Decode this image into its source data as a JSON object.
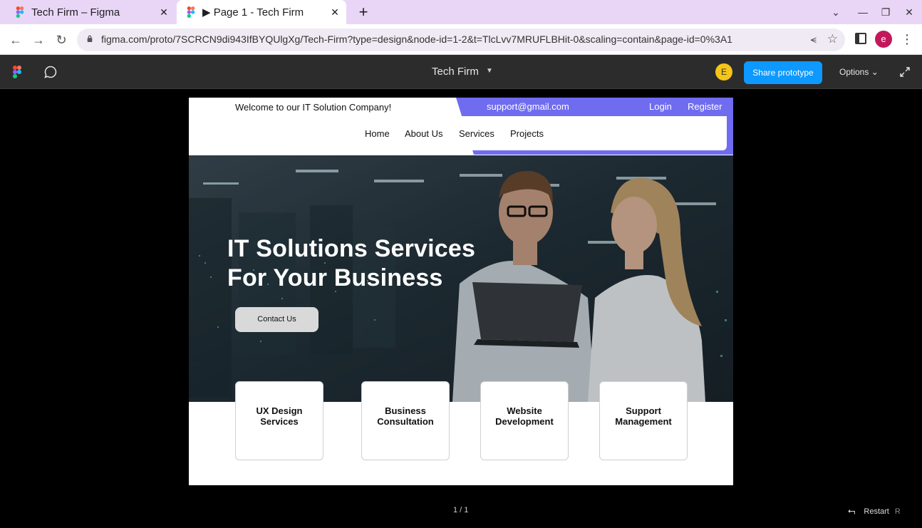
{
  "browser": {
    "tabs": [
      {
        "title": "Tech Firm – Figma",
        "active": false
      },
      {
        "title": "▶ Page 1 - Tech Firm",
        "active": true
      }
    ],
    "new_tab_symbol": "+",
    "tab_close_symbol": "✕",
    "url": "figma.com/proto/7SCRCN9di943IfBYQUlgXg/Tech-Firm?type=design&node-id=1-2&t=TlcLvv7MRUFLBHit-0&scaling=contain&page-id=0%3A1",
    "profile_initial": "e",
    "profile_color": "#c2185b"
  },
  "figma_toolbar": {
    "file_title": "Tech Firm",
    "user_initial": "E",
    "share_label": "Share prototype",
    "options_label": "Options",
    "accent": "#0d99ff"
  },
  "site": {
    "welcome": "Welcome to our IT Solution Company!",
    "email": "support@gmail.com",
    "login": "Login",
    "register": "Register",
    "accent": "#6f6cf0",
    "nav": [
      "Home",
      "About Us",
      "Services",
      "Projects"
    ],
    "hero": {
      "title_line1": "IT Solutions Services",
      "title_line2": "For Your Business",
      "cta": "Contact Us"
    },
    "services": [
      "UX  Design\nServices",
      "Business\nConsultation",
      "Website\nDevelopment",
      "Support\nManagement"
    ]
  },
  "footer": {
    "pager": "1 / 1",
    "restart_label": "Restart",
    "restart_key": "R"
  }
}
